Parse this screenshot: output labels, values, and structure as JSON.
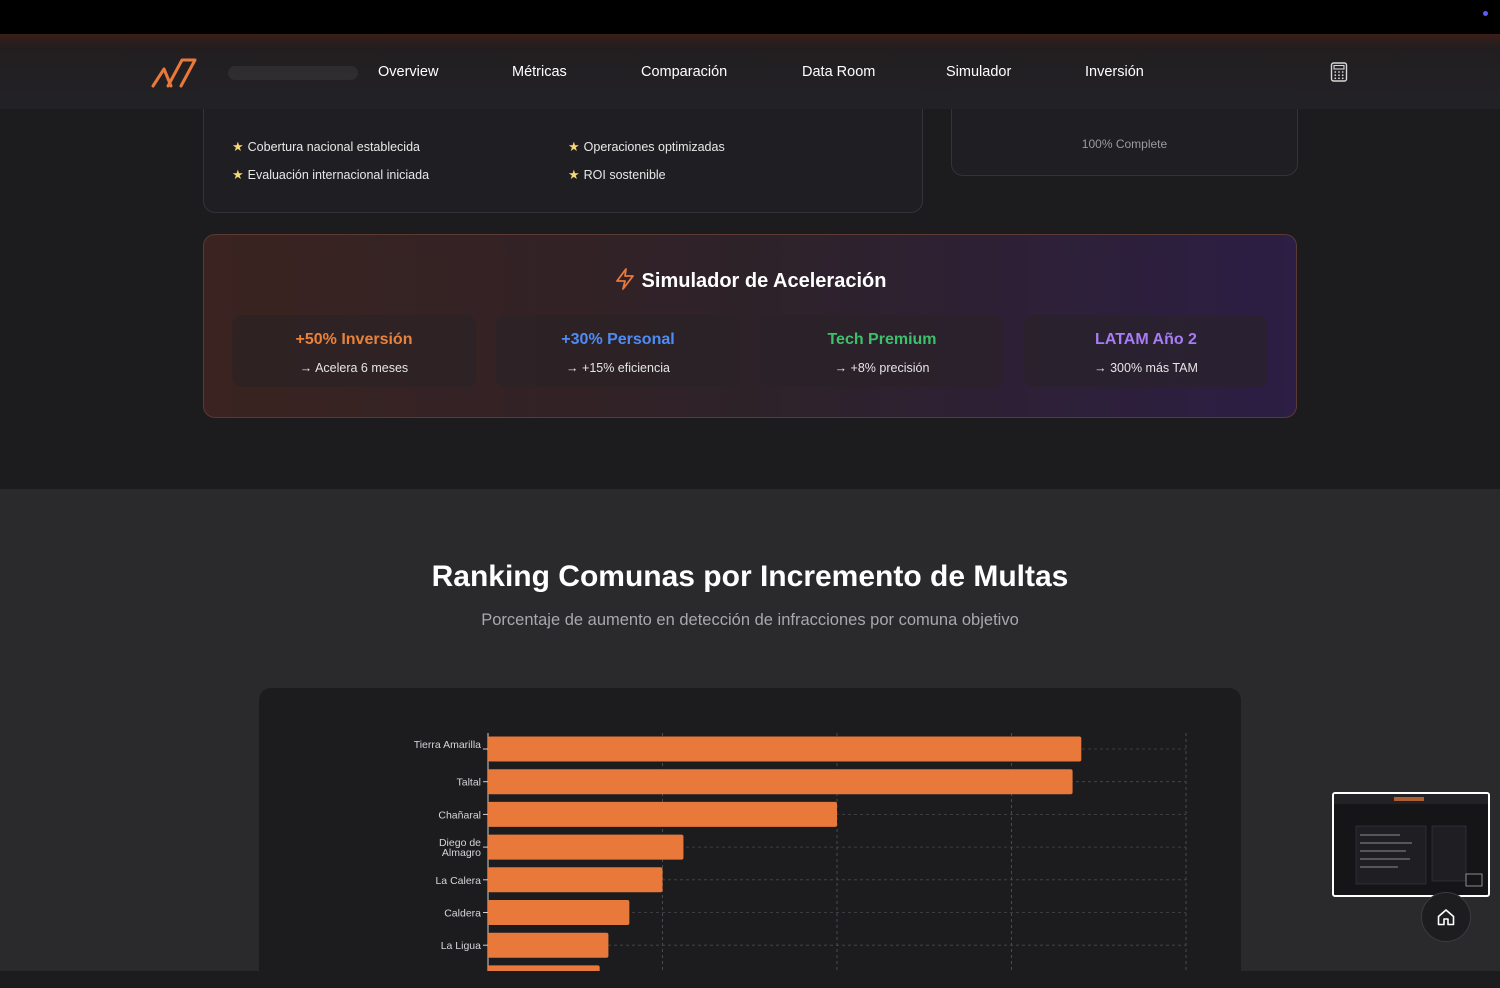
{
  "nav": {
    "items": [
      "Overview",
      "Métricas",
      "Comparación",
      "Data Room",
      "Simulador",
      "Inversión"
    ],
    "logo_icon": "brand-logo-icon",
    "calculator_icon": "calculator-icon"
  },
  "features_left": [
    "Cobertura nacional establecida",
    "Evaluación internacional iniciada"
  ],
  "features_right": [
    "Operaciones optimizadas",
    "ROI sostenible"
  ],
  "progress_card": {
    "status": "100% Complete"
  },
  "simulator": {
    "title": "Simulador de Aceleración",
    "cards": [
      {
        "title": "+50% Inversión",
        "subtitle": "→ Acelera 6 meses",
        "color": "#e8823a"
      },
      {
        "title": "+30% Personal",
        "subtitle": "→ +15% eficiencia",
        "color": "#4e8cf5"
      },
      {
        "title": "Tech Premium",
        "subtitle": "→ +8% precisión",
        "color": "#3dc06a"
      },
      {
        "title": "LATAM Año 2",
        "subtitle": "→ 300% más TAM",
        "color": "#a77cf5"
      }
    ]
  },
  "ranking": {
    "title": "Ranking Comunas por Incremento de Multas",
    "subtitle": "Porcentaje de aumento en detección de infracciones por comuna objetivo"
  },
  "chart_data": {
    "type": "bar",
    "orientation": "horizontal",
    "categories": [
      "Tierra Amarilla",
      "Taltal",
      "Chañaral",
      "Diego de Almagro",
      "La Calera",
      "Caldera",
      "La Ligua",
      ""
    ],
    "values": [
      34,
      33.5,
      20,
      11.2,
      10,
      8.1,
      6.9,
      6.4
    ],
    "xlim": [
      0,
      40
    ],
    "grid": true,
    "bar_color": "#e8793a",
    "title": "",
    "xlabel": "",
    "ylabel": ""
  },
  "colors": {
    "accent": "#e8793a",
    "background": "#1c1c1f",
    "section_alt": "#2a2a2d"
  },
  "floating": {
    "home_icon": "home-icon",
    "thumbnail": "page-thumbnail"
  }
}
